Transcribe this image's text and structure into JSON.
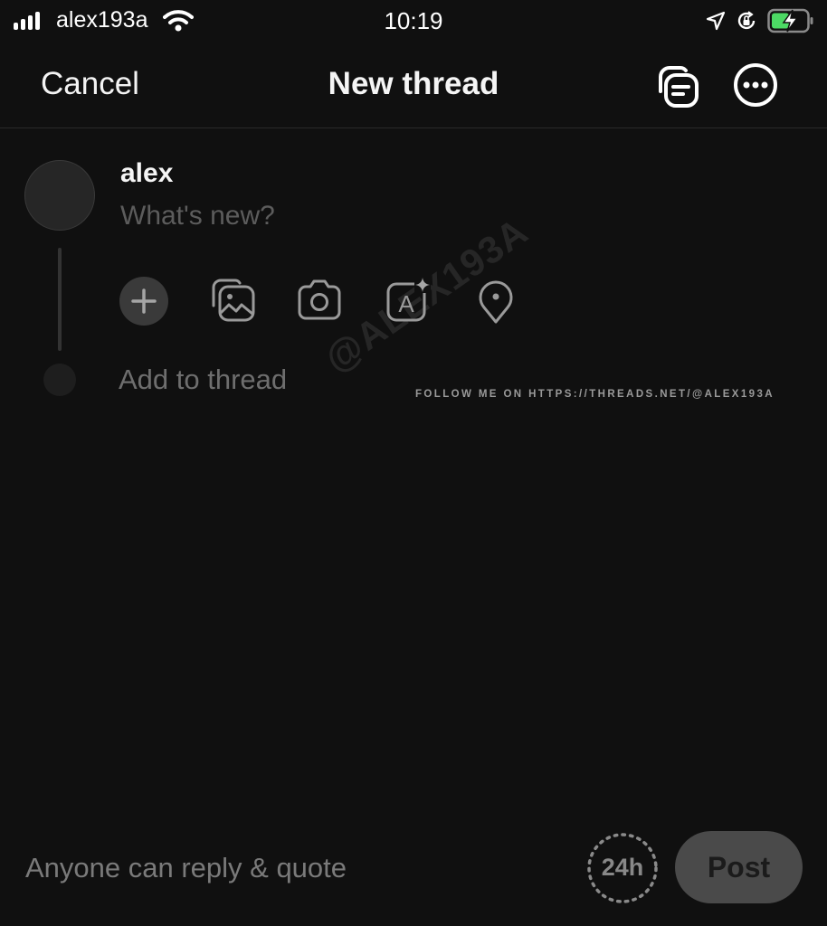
{
  "status_bar": {
    "carrier": "alex193a",
    "time": "10:19",
    "icons": [
      "signal-icon",
      "wifi-icon",
      "location-icon",
      "orientation-lock-icon",
      "battery-charging-icon"
    ],
    "battery_color": "#4cd964"
  },
  "header": {
    "cancel_label": "Cancel",
    "title": "New thread",
    "actions": [
      "drafts-icon",
      "more-options-icon"
    ]
  },
  "compose": {
    "username": "alex",
    "input_value": "",
    "input_placeholder": "What's new?",
    "attachments": [
      {
        "name": "add-icon"
      },
      {
        "name": "gallery-icon"
      },
      {
        "name": "camera-icon"
      },
      {
        "name": "ai-text-icon"
      },
      {
        "name": "location-pin-icon"
      }
    ],
    "add_to_thread_label": "Add to thread"
  },
  "watermark": {
    "handle": "@ALEX193A",
    "follow_text": "FOLLOW ME ON HTTPS://THREADS.NET/@ALEX193A"
  },
  "footer": {
    "reply_setting": "Anyone can reply & quote",
    "timer_label": "24h",
    "post_label": "Post"
  }
}
